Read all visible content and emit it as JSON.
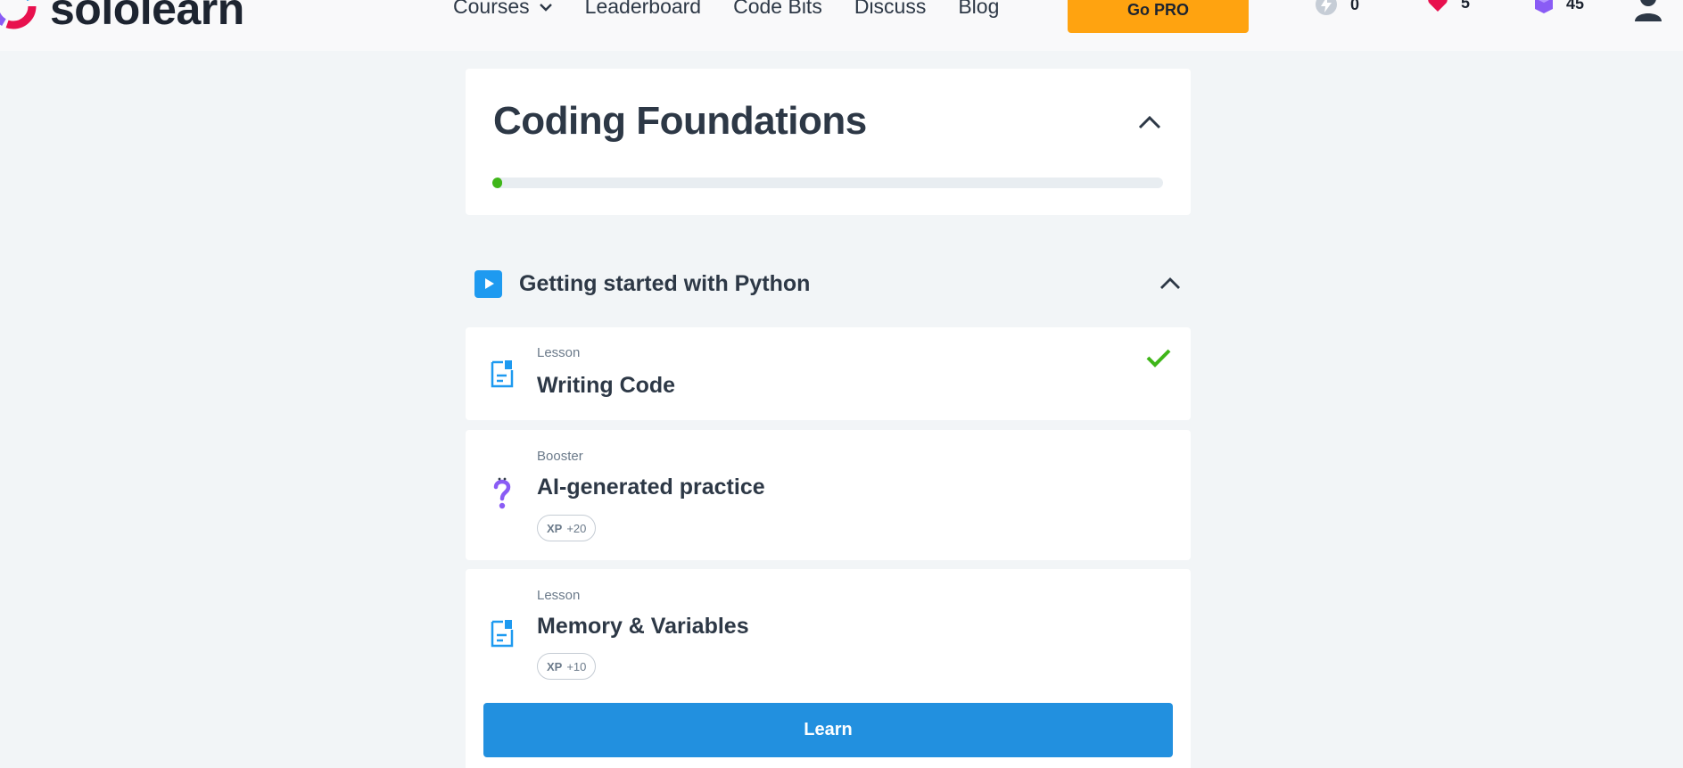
{
  "header": {
    "logo_text": "sololearn",
    "nav": [
      {
        "label": "Courses",
        "icon": "chevron-down-icon"
      },
      {
        "label": "Leaderboard"
      },
      {
        "label": "Code Bits"
      },
      {
        "label": "Discuss"
      },
      {
        "label": "Blog"
      }
    ],
    "gopro_label": "Go PRO",
    "stats": {
      "streak": "0",
      "hearts": "5",
      "gems": "45"
    }
  },
  "course": {
    "title": "Coding Foundations",
    "progress_percent": 1.5
  },
  "module": {
    "title": "Getting started with Python"
  },
  "lessons": [
    {
      "type": "Lesson",
      "title": "Writing Code",
      "completed": true,
      "icon": "lesson-doc-icon"
    },
    {
      "type": "Booster",
      "title": "AI-generated practice",
      "xp_label": "XP",
      "xp_value": "+20",
      "icon": "question-mark-icon"
    },
    {
      "type": "Lesson",
      "title": "Memory & Variables",
      "xp_label": "XP",
      "xp_value": "+10",
      "icon": "lesson-doc-icon",
      "button_label": "Learn"
    }
  ],
  "colors": {
    "accent_blue": "#2290df",
    "gopro_orange": "#ffa310",
    "success_green": "#3fb619",
    "heart_red": "#e8114e",
    "gem_purple": "#8a5cf5"
  }
}
